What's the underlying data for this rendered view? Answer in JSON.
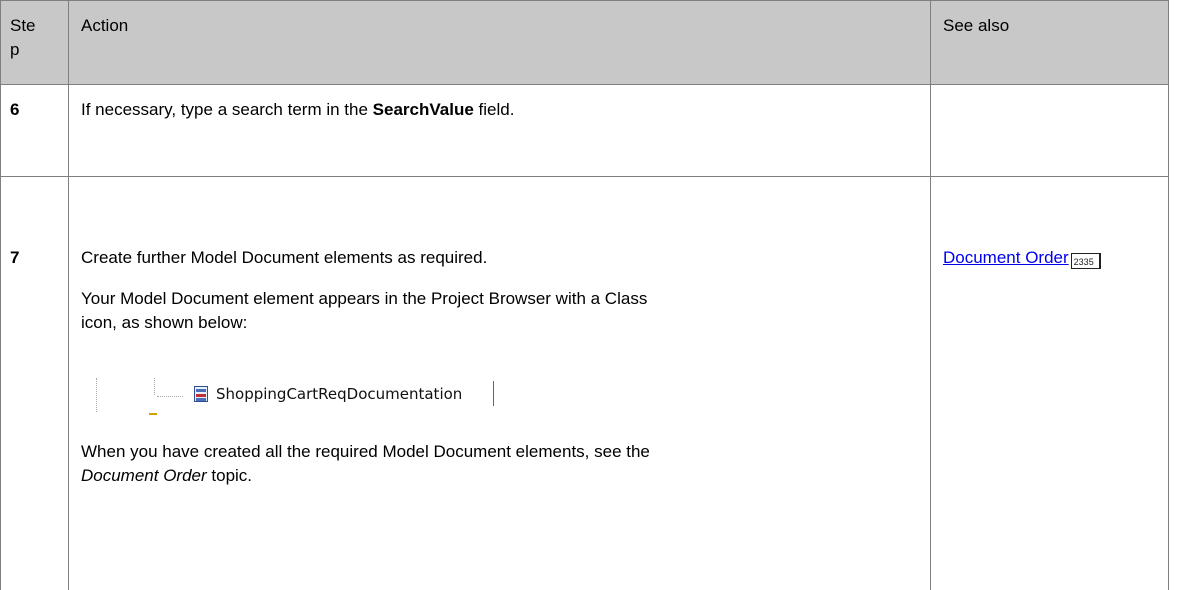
{
  "header": {
    "step_label_line1": "Ste",
    "step_label_line2": "p",
    "action_label": "Action",
    "see_also_label": "See also"
  },
  "rows": [
    {
      "step": "6",
      "text_before": "If necessary, type a search term in the ",
      "text_bold": "SearchValue",
      "text_after": " field."
    },
    {
      "step": "7",
      "line1": "Create further Model Document elements as required.",
      "line2a": "Your Model Document element appears in the Project Browser with a Class",
      "line2b": "icon, as shown below:",
      "tree_item_icon": "class-icon",
      "tree_item_label": "ShoppingCartReqDocumentation",
      "line3a": "When you have created all the required Model Document elements, see the",
      "line3b_italic": "Document Order",
      "line3b_after": " topic.",
      "see_also_link": "Document Order",
      "see_also_page": "2335"
    }
  ],
  "colors": {
    "header_bg": "#c8c8c8",
    "border": "#7f7f7f",
    "link": "#0000ee"
  }
}
